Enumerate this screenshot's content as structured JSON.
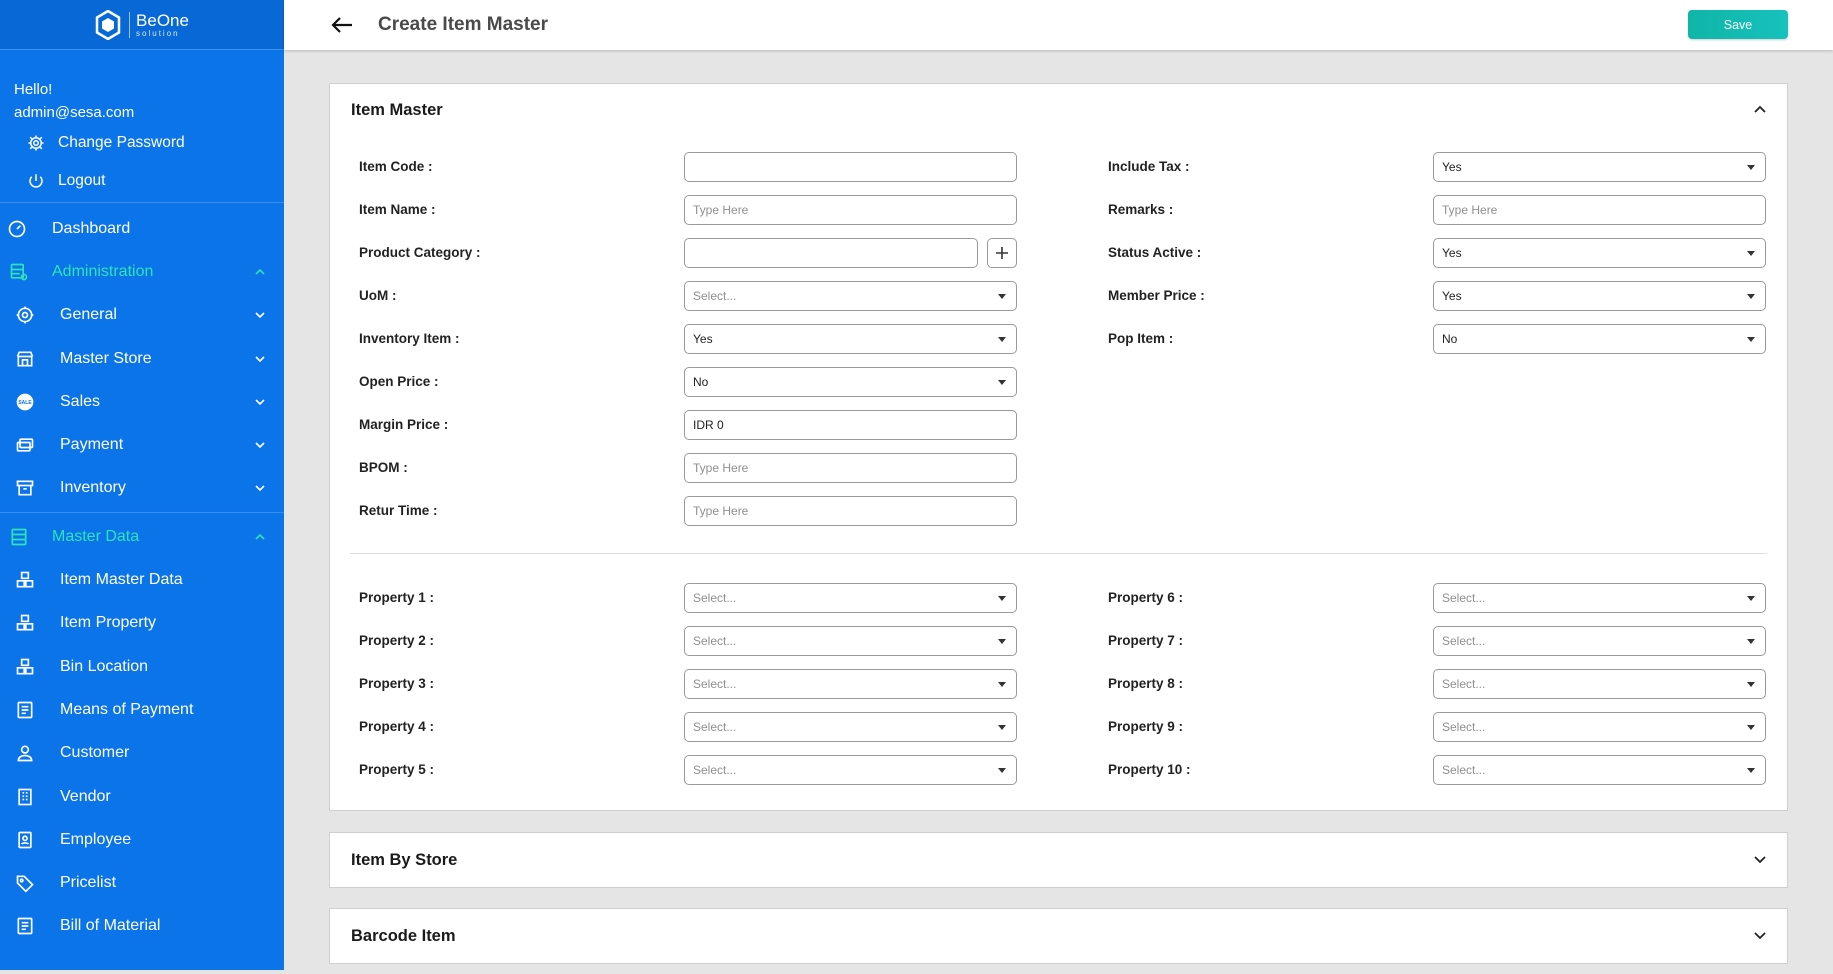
{
  "brand": {
    "name": "BeOne",
    "tagline": "solution"
  },
  "user": {
    "greeting": "Hello!",
    "email": "admin@sesa.com"
  },
  "account_menu": [
    {
      "label": "Change Password",
      "icon": "gear-icon"
    },
    {
      "label": "Logout",
      "icon": "power-icon"
    }
  ],
  "sidebar": {
    "dashboard": "Dashboard",
    "administration": "Administration",
    "admin_items": [
      {
        "label": "General",
        "icon": "gear-icon"
      },
      {
        "label": "Master Store",
        "icon": "store-icon"
      },
      {
        "label": "Sales",
        "icon": "sale-badge-icon"
      },
      {
        "label": "Payment",
        "icon": "payment-icon"
      },
      {
        "label": "Inventory",
        "icon": "inventory-box-icon"
      }
    ],
    "master_data": "Master Data",
    "master_items": [
      {
        "label": "Item Master Data",
        "icon": "boxes-icon"
      },
      {
        "label": "Item Property",
        "icon": "boxes-icon"
      },
      {
        "label": "Bin Location",
        "icon": "boxes-icon"
      },
      {
        "label": "Means of Payment",
        "icon": "document-icon"
      },
      {
        "label": "Customer",
        "icon": "person-icon"
      },
      {
        "label": "Vendor",
        "icon": "building-icon"
      },
      {
        "label": "Employee",
        "icon": "badge-icon"
      },
      {
        "label": "Pricelist",
        "icon": "tag-icon"
      },
      {
        "label": "Bill of Material",
        "icon": "document-icon"
      }
    ]
  },
  "header": {
    "title": "Create Item Master",
    "save_label": "Save"
  },
  "item_master": {
    "title": "Item Master",
    "left": [
      {
        "label": "Item Code :",
        "value": "",
        "placeholder": "",
        "type": "text"
      },
      {
        "label": "Item Name :",
        "value": "",
        "placeholder": "Type Here",
        "type": "text"
      },
      {
        "label": "Product Category :",
        "value": "",
        "placeholder": "",
        "type": "text-plus"
      },
      {
        "label": "UoM :",
        "value": "",
        "placeholder": "Select...",
        "type": "select"
      },
      {
        "label": "Inventory Item :",
        "value": "Yes",
        "placeholder": "",
        "type": "select"
      },
      {
        "label": "Open Price :",
        "value": "No",
        "placeholder": "",
        "type": "select"
      },
      {
        "label": "Margin Price :",
        "value": "IDR 0",
        "placeholder": "",
        "type": "text"
      },
      {
        "label": "BPOM :",
        "value": "",
        "placeholder": "Type Here",
        "type": "text"
      },
      {
        "label": "Retur Time :",
        "value": "",
        "placeholder": "Type Here",
        "type": "text"
      }
    ],
    "right": [
      {
        "label": "Include Tax :",
        "value": "Yes",
        "placeholder": "",
        "type": "select"
      },
      {
        "label": "Remarks :",
        "value": "",
        "placeholder": "Type Here",
        "type": "text"
      },
      {
        "label": "Status Active :",
        "value": "Yes",
        "placeholder": "",
        "type": "select"
      },
      {
        "label": "Member Price :",
        "value": "Yes",
        "placeholder": "",
        "type": "select"
      },
      {
        "label": "Pop Item :",
        "value": "No",
        "placeholder": "",
        "type": "select"
      }
    ],
    "properties_left": [
      {
        "label": "Property 1 :",
        "placeholder": "Select..."
      },
      {
        "label": "Property 2 :",
        "placeholder": "Select..."
      },
      {
        "label": "Property 3 :",
        "placeholder": "Select..."
      },
      {
        "label": "Property 4 :",
        "placeholder": "Select..."
      },
      {
        "label": "Property 5 :",
        "placeholder": "Select..."
      }
    ],
    "properties_right": [
      {
        "label": "Property 6 :",
        "placeholder": "Select..."
      },
      {
        "label": "Property 7 :",
        "placeholder": "Select..."
      },
      {
        "label": "Property 8 :",
        "placeholder": "Select..."
      },
      {
        "label": "Property 9 :",
        "placeholder": "Select..."
      },
      {
        "label": "Property 10 :",
        "placeholder": "Select..."
      }
    ]
  },
  "sections": {
    "item_by_store": "Item By Store",
    "barcode_item": "Barcode Item"
  },
  "colors": {
    "sidebar": "#0a74e8",
    "section_accent": "#2ee3b8",
    "save_button": "#13bcb1"
  }
}
